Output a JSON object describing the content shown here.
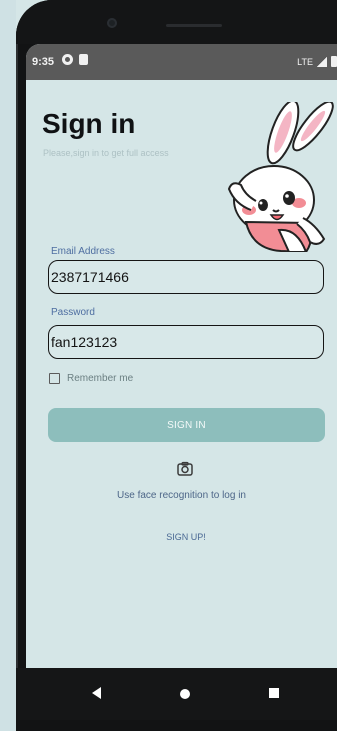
{
  "status_bar": {
    "time": "9:35",
    "network": "LTE"
  },
  "header": {
    "title": "Sign in",
    "subtitle": "Please,sign in to get full access"
  },
  "form": {
    "email_label": "Email Address",
    "email_value": "2387171466",
    "password_label": "Password",
    "password_value": "fan123123",
    "remember_label": "Remember me",
    "signin_label": "SIGN IN"
  },
  "auth": {
    "face_text": "Use face recognition to log in",
    "signup_label": "SIGN UP!"
  },
  "icons": {
    "camera": "camera-icon",
    "mascot": "rabbit-mascot",
    "back": "back-icon",
    "home": "home-icon",
    "recents": "recents-icon"
  },
  "colors": {
    "screen_bg": "#d5e6e7",
    "label_blue": "#4e6ea1",
    "button_teal": "#8dbebc"
  }
}
